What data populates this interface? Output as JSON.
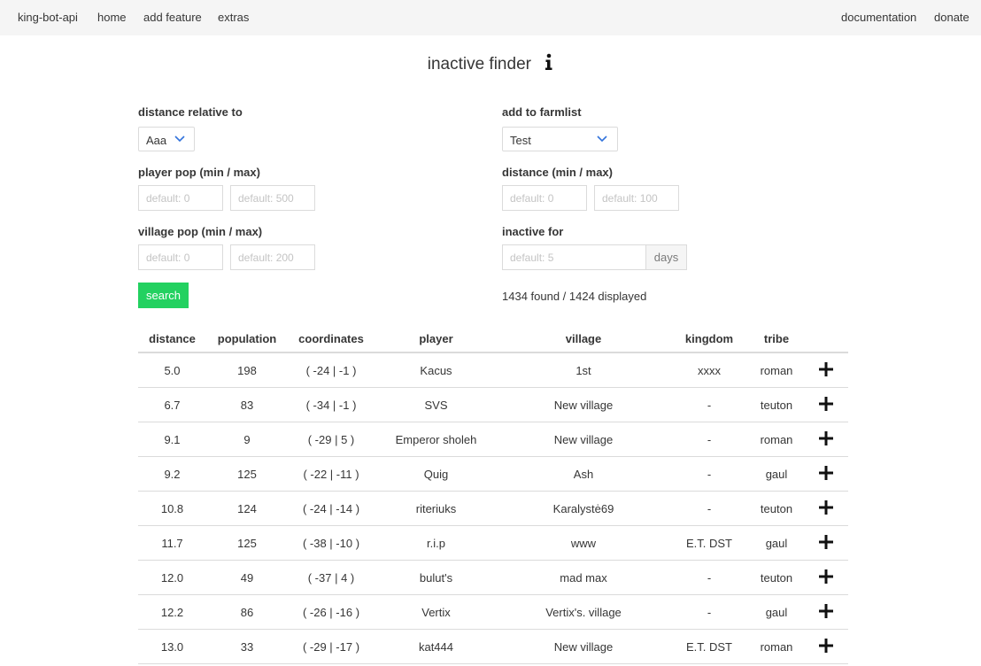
{
  "nav": {
    "brand": "king-bot-api",
    "home": "home",
    "add_feature": "add feature",
    "extras": "extras",
    "documentation": "documentation",
    "donate": "donate"
  },
  "page": {
    "title": "inactive finder"
  },
  "form": {
    "distance_relative_label": "distance relative to",
    "distance_relative_value": "Aaa",
    "add_to_farmlist_label": "add to farmlist",
    "farmlist_value": "Test",
    "player_pop_label": "player pop (min / max)",
    "player_pop_min_placeholder": "default: 0",
    "player_pop_max_placeholder": "default: 500",
    "distance_label": "distance (min / max)",
    "distance_min_placeholder": "default: 0",
    "distance_max_placeholder": "default: 100",
    "village_pop_label": "village pop (min / max)",
    "village_pop_min_placeholder": "default: 0",
    "village_pop_max_placeholder": "default: 200",
    "inactive_for_label": "inactive for",
    "inactive_for_placeholder": "default: 5",
    "days_addon": "days",
    "search_button": "search",
    "result_summary": "1434 found / 1424 displayed"
  },
  "table": {
    "headers": [
      "distance",
      "population",
      "coordinates",
      "player",
      "village",
      "kingdom",
      "tribe"
    ],
    "rows": [
      [
        "5.0",
        "198",
        "( -24 | -1 )",
        "Kacus",
        "1st",
        "xxxx",
        "roman"
      ],
      [
        "6.7",
        "83",
        "( -34 | -1 )",
        "SVS",
        "New village",
        "-",
        "teuton"
      ],
      [
        "9.1",
        "9",
        "( -29 | 5 )",
        "Emperor sholeh",
        "New village",
        "-",
        "roman"
      ],
      [
        "9.2",
        "125",
        "( -22 | -11 )",
        "Quig",
        "Ash",
        "-",
        "gaul"
      ],
      [
        "10.8",
        "124",
        "( -24 | -14 )",
        "riteriuks",
        "Karalystė69",
        "-",
        "teuton"
      ],
      [
        "11.7",
        "125",
        "( -38 | -10 )",
        "r.i.p",
        "www",
        "E.T. DST",
        "gaul"
      ],
      [
        "12.0",
        "49",
        "( -37 | 4 )",
        "bulut's",
        "mad max",
        "-",
        "teuton"
      ],
      [
        "12.2",
        "86",
        "( -26 | -16 )",
        "Vertix",
        "Vertix's. village",
        "-",
        "gaul"
      ],
      [
        "13.0",
        "33",
        "( -29 | -17 )",
        "kat444",
        "New village",
        "E.T. DST",
        "roman"
      ]
    ]
  },
  "colors": {
    "accent_green": "#23d160",
    "select_arrow": "#3273dc",
    "navbar_bg": "#f5f5f5"
  },
  "icons": {
    "info": "info-icon",
    "add": "plus-icon",
    "dropdown": "chevron-down-icon"
  }
}
